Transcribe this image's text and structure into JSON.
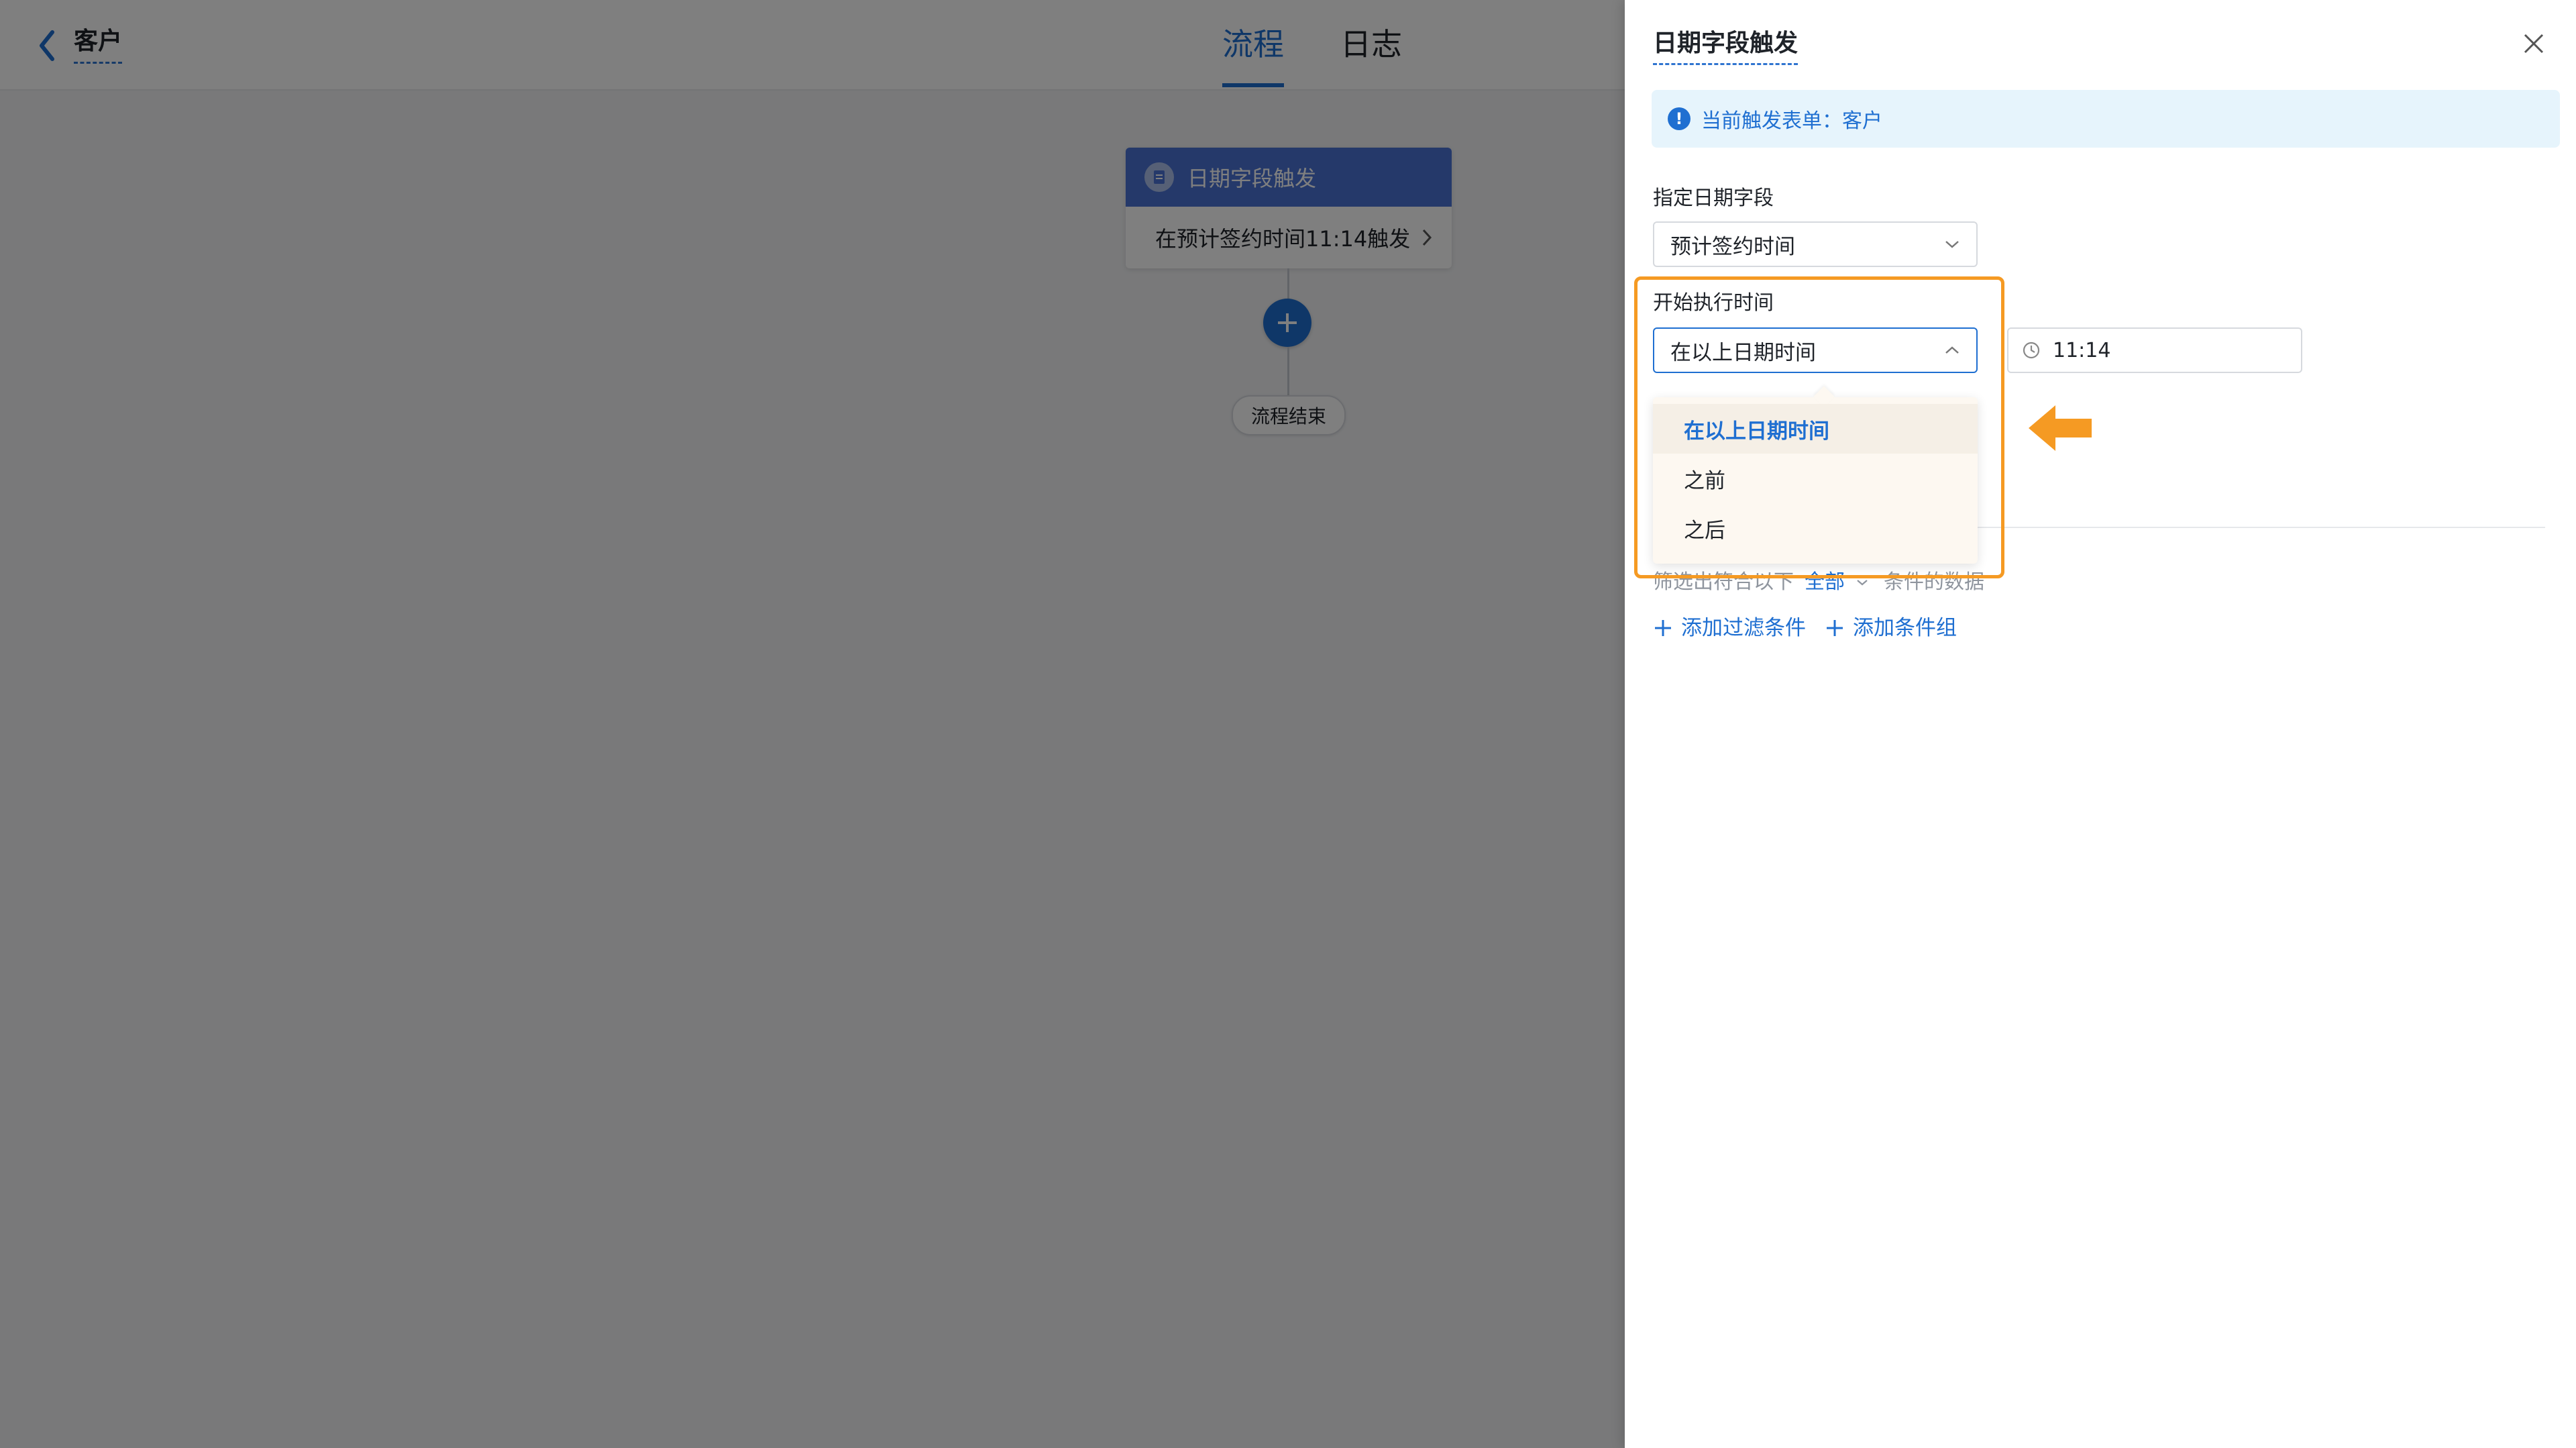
{
  "header": {
    "back_label": "客户",
    "tabs": [
      {
        "label": "流程",
        "active": true
      },
      {
        "label": "日志",
        "active": false
      }
    ]
  },
  "flow": {
    "trigger_title": "日期字段触发",
    "trigger_desc": "在预计签约时间11:14触发",
    "end_label": "流程结束"
  },
  "drawer": {
    "title": "日期字段触发",
    "info_text": "当前触发表单：客户",
    "date_field": {
      "label": "指定日期字段",
      "value": "预计签约时间"
    },
    "start_time": {
      "label": "开始执行时间",
      "value": "在以上日期时间",
      "time_value": "11:14",
      "options": [
        {
          "label": "在以上日期时间",
          "selected": true
        },
        {
          "label": "之前",
          "selected": false
        },
        {
          "label": "之后",
          "selected": false
        }
      ]
    },
    "filter": {
      "prefix": "筛选出符合以下",
      "mode": "全部",
      "suffix": "条件的数据",
      "add_condition": "添加过滤条件",
      "add_group": "添加条件组"
    }
  },
  "colors": {
    "primary": "#1f6fd1",
    "annotation": "#f59a23",
    "trigger_header": "#4a73d4"
  }
}
